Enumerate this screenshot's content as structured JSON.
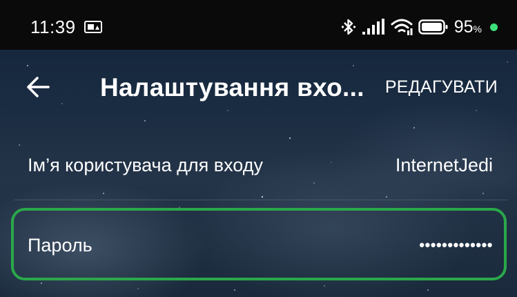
{
  "status_bar": {
    "time": "11:39",
    "battery_level": "95",
    "battery_sign": "%",
    "icons": [
      "screenshot-notification-icon",
      "bluetooth-icon",
      "cellular-signal-icon",
      "wifi-icon",
      "battery-icon",
      "charging-dot-icon"
    ],
    "charging_dot_color": "#3be07a"
  },
  "toolbar": {
    "back_icon": "arrow-left-icon",
    "title": "Налаштування вхо...",
    "edit_label": "РЕДАГУВАТИ"
  },
  "settings": {
    "username_row": {
      "label": "Ім’я користувача для входу",
      "value": "InternetJedi"
    },
    "password_row": {
      "label": "Пароль",
      "value": "•••••••••••••"
    }
  },
  "highlight": {
    "color": "#2aa84a",
    "target": "password_row"
  }
}
